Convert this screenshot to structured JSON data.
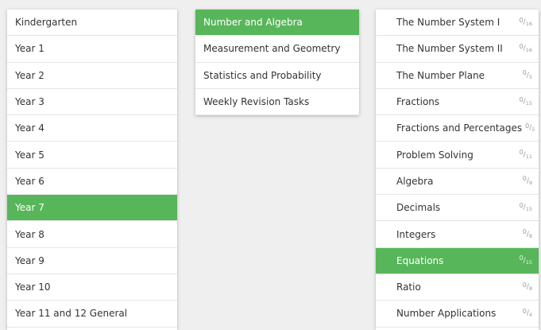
{
  "years": {
    "selected_index": 7,
    "items": [
      "Kindergarten",
      "Year 1",
      "Year 2",
      "Year 3",
      "Year 4",
      "Year 5",
      "Year 6",
      "Year 7",
      "Year 8",
      "Year 9",
      "Year 10",
      "Year 11 and 12 General"
    ]
  },
  "strands": {
    "selected_index": 0,
    "items": [
      "Number and Algebra",
      "Measurement and Geometry",
      "Statistics and Probability",
      "Weekly Revision Tasks"
    ]
  },
  "topics": {
    "selected_index": 9,
    "items": [
      {
        "label": "The Number System I",
        "done": "0",
        "total": "16"
      },
      {
        "label": "The Number System II",
        "done": "0",
        "total": "16"
      },
      {
        "label": "The Number Plane",
        "done": "0",
        "total": "5"
      },
      {
        "label": "Fractions",
        "done": "0",
        "total": "15"
      },
      {
        "label": "Fractions and Percentages",
        "done": "0",
        "total": "5"
      },
      {
        "label": "Problem Solving",
        "done": "0",
        "total": "11"
      },
      {
        "label": "Algebra",
        "done": "0",
        "total": "9"
      },
      {
        "label": "Decimals",
        "done": "0",
        "total": "15"
      },
      {
        "label": "Integers",
        "done": "0",
        "total": "8"
      },
      {
        "label": "Equations",
        "done": "0",
        "total": "15"
      },
      {
        "label": "Ratio",
        "done": "0",
        "total": "8"
      },
      {
        "label": "Number Applications",
        "done": "0",
        "total": "4"
      }
    ]
  },
  "colors": {
    "accent": "#57b65a",
    "background": "#efefef"
  }
}
